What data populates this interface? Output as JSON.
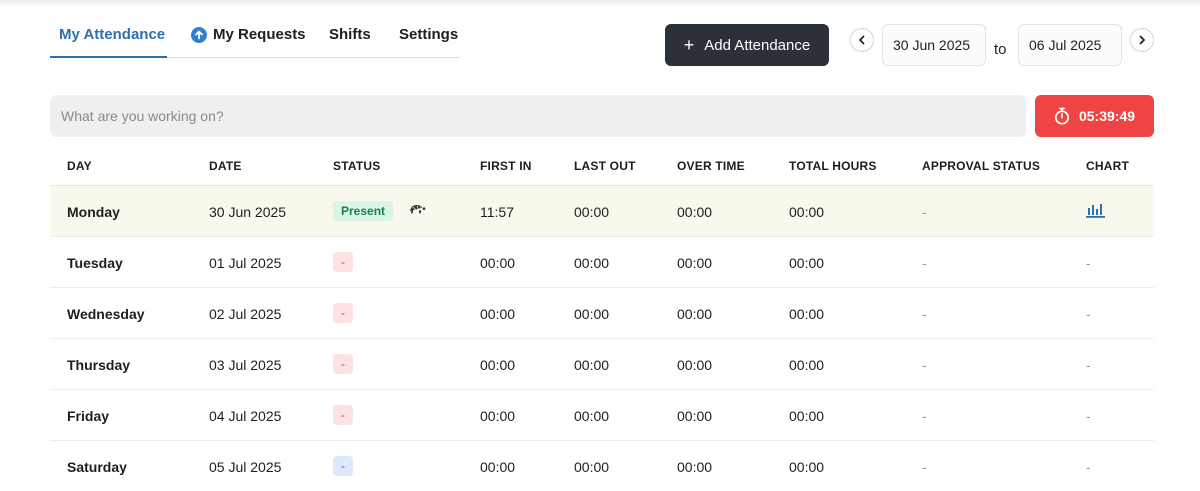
{
  "tabs": [
    {
      "label": "My Attendance",
      "active": true
    },
    {
      "label": "My Requests",
      "active": false
    },
    {
      "label": "Shifts",
      "active": false
    },
    {
      "label": "Settings",
      "active": false
    }
  ],
  "toolbar": {
    "add_label": "Add Attendance",
    "date_from": "30 Jun 2025",
    "to_label": "to",
    "date_to": "06 Jul 2025"
  },
  "search": {
    "placeholder": "What are you working on?"
  },
  "timer": {
    "value": "05:39:49"
  },
  "colors": {
    "accent": "#2f6fb0",
    "timer": "#ef4444",
    "button": "#2c3038",
    "highlight_row": "#f8f8ec"
  },
  "table": {
    "headers": [
      "DAY",
      "DATE",
      "STATUS",
      "FIRST IN",
      "LAST OUT",
      "OVER TIME",
      "TOTAL HOURS",
      "APPROVAL STATUS",
      "CHART"
    ],
    "rows": [
      {
        "day": "Monday",
        "date": "30 Jun 2025",
        "status": "Present",
        "status_type": "present",
        "first_in": "11:57",
        "last_out": "00:00",
        "over_time": "00:00",
        "total_hours": "00:00",
        "approval": "-",
        "chart": "bar-chart-icon"
      },
      {
        "day": "Tuesday",
        "date": "01 Jul 2025",
        "status": "-",
        "status_type": "red",
        "first_in": "00:00",
        "last_out": "00:00",
        "over_time": "00:00",
        "total_hours": "00:00",
        "approval": "-",
        "chart": "-"
      },
      {
        "day": "Wednesday",
        "date": "02 Jul 2025",
        "status": "-",
        "status_type": "red",
        "first_in": "00:00",
        "last_out": "00:00",
        "over_time": "00:00",
        "total_hours": "00:00",
        "approval": "-",
        "chart": "-"
      },
      {
        "day": "Thursday",
        "date": "03 Jul 2025",
        "status": "-",
        "status_type": "red",
        "first_in": "00:00",
        "last_out": "00:00",
        "over_time": "00:00",
        "total_hours": "00:00",
        "approval": "-",
        "chart": "-"
      },
      {
        "day": "Friday",
        "date": "04 Jul 2025",
        "status": "-",
        "status_type": "red",
        "first_in": "00:00",
        "last_out": "00:00",
        "over_time": "00:00",
        "total_hours": "00:00",
        "approval": "-",
        "chart": "-"
      },
      {
        "day": "Saturday",
        "date": "05 Jul 2025",
        "status": "-",
        "status_type": "blue",
        "first_in": "00:00",
        "last_out": "00:00",
        "over_time": "00:00",
        "total_hours": "00:00",
        "approval": "-",
        "chart": "-"
      }
    ]
  }
}
